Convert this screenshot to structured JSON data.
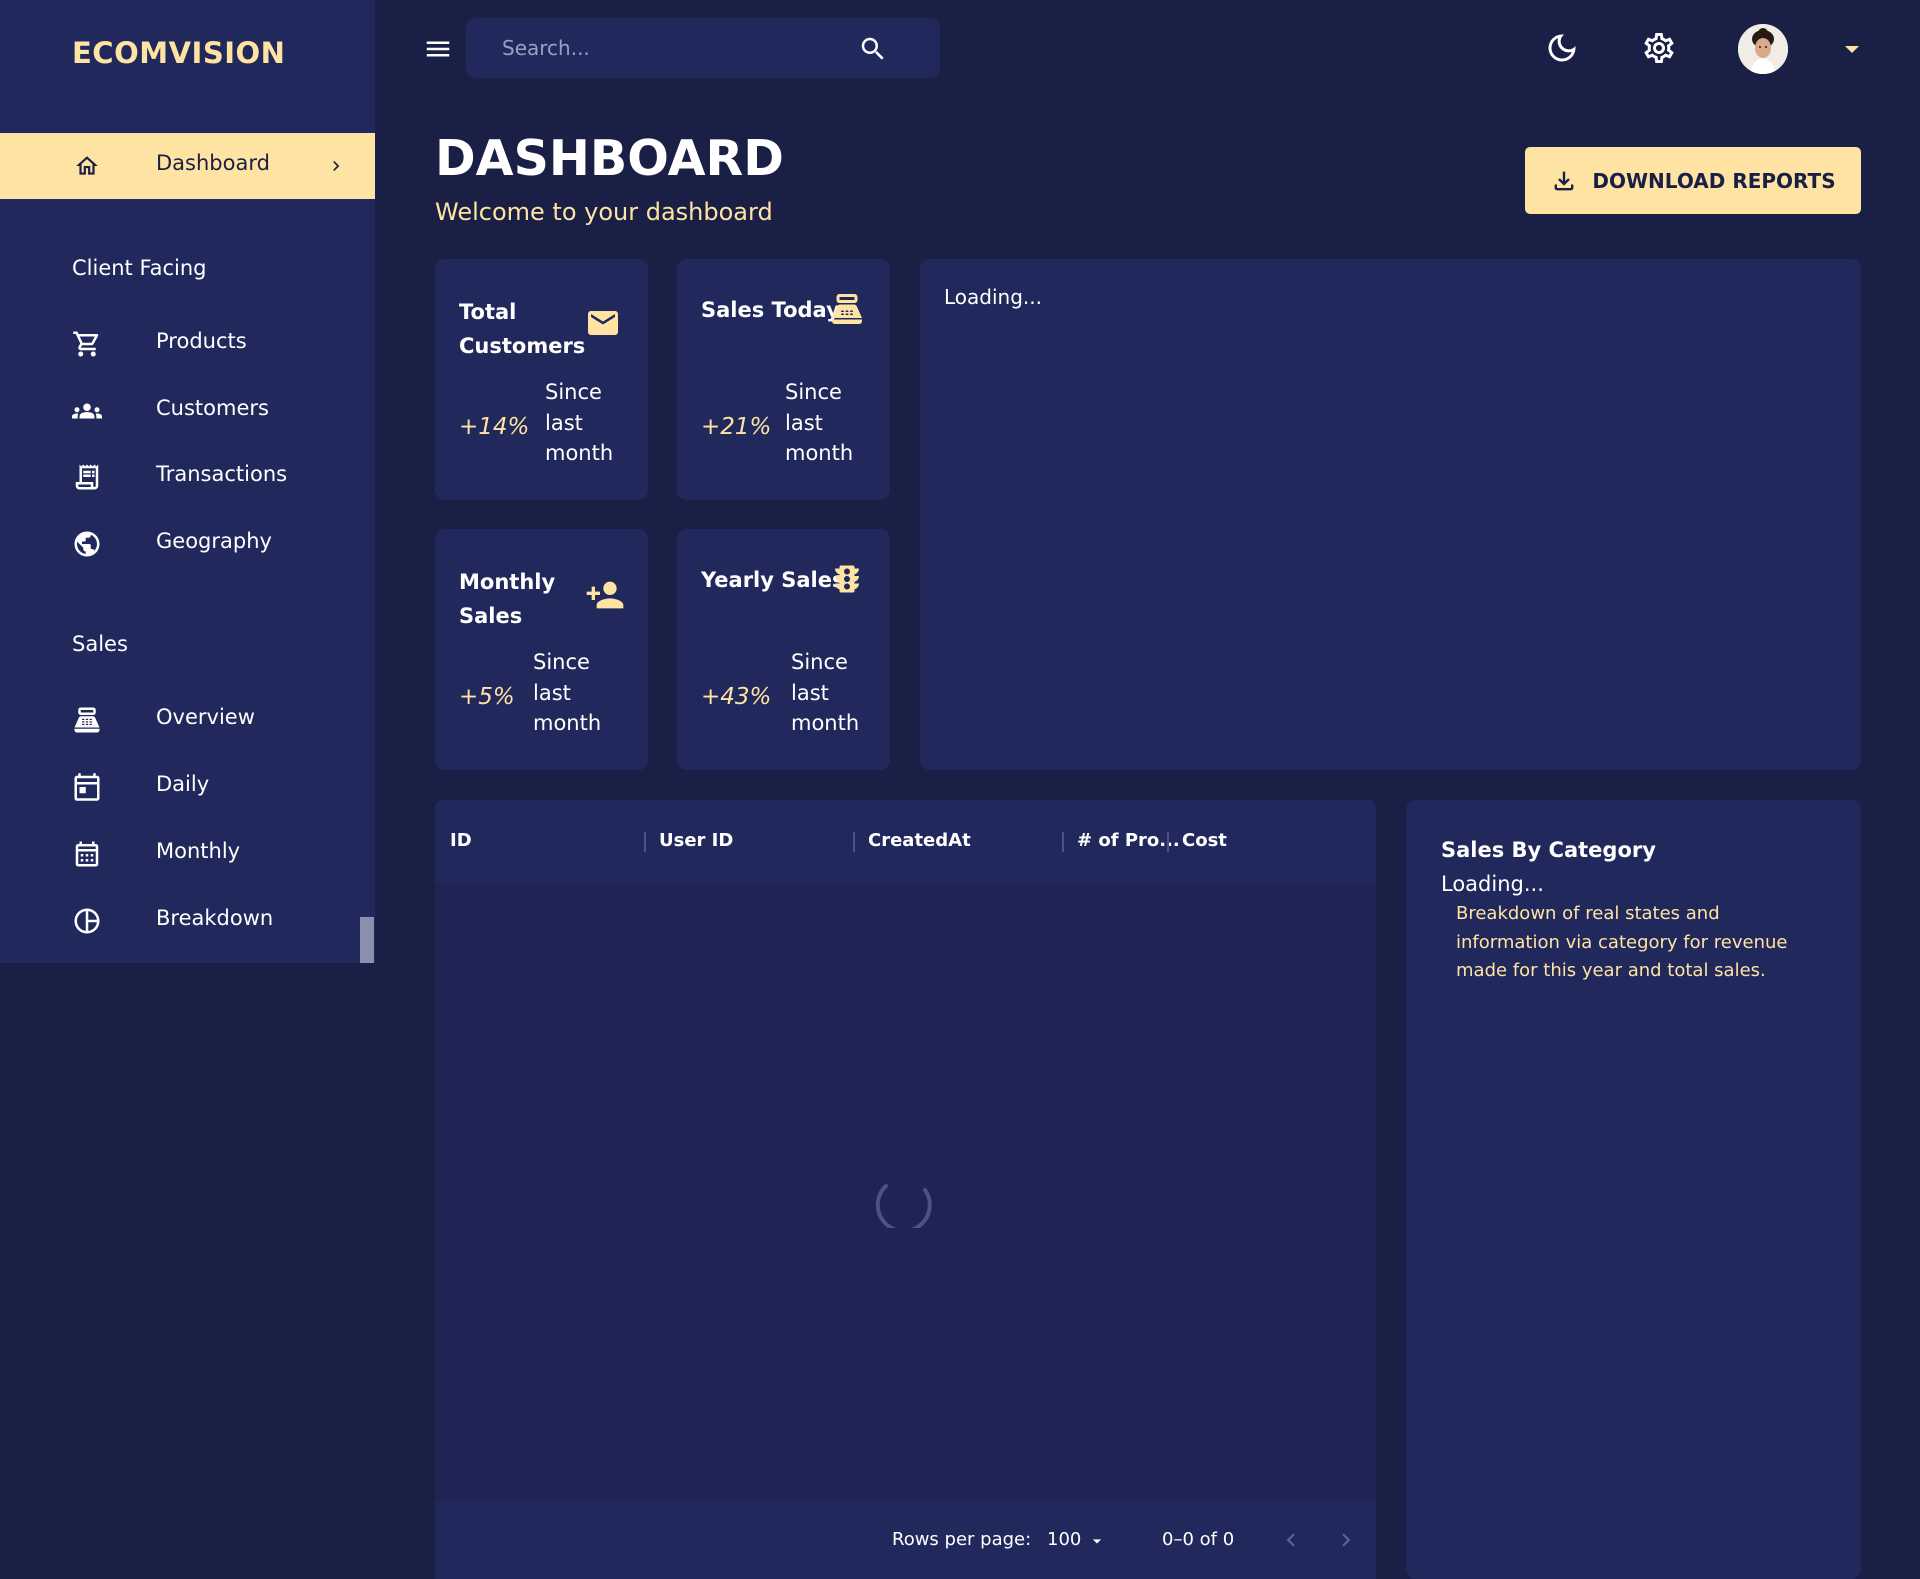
{
  "sidebar": {
    "brand": "ECOMVISION",
    "active_item": {
      "label": "Dashboard",
      "icon": "home-icon"
    },
    "sections": [
      {
        "title": "Client Facing",
        "items": [
          {
            "label": "Products",
            "icon": "shopping-cart-icon"
          },
          {
            "label": "Customers",
            "icon": "groups-icon"
          },
          {
            "label": "Transactions",
            "icon": "receipt-icon"
          },
          {
            "label": "Geography",
            "icon": "globe-icon"
          }
        ]
      },
      {
        "title": "Sales",
        "items": [
          {
            "label": "Overview",
            "icon": "point-of-sale-icon"
          },
          {
            "label": "Daily",
            "icon": "calendar-today-icon"
          },
          {
            "label": "Monthly",
            "icon": "calendar-month-icon"
          },
          {
            "label": "Breakdown",
            "icon": "pie-chart-icon"
          }
        ]
      }
    ]
  },
  "topbar": {
    "search_placeholder": "Search...",
    "icons": [
      "menu-icon",
      "search-icon",
      "dark-mode-icon",
      "settings-icon",
      "avatar",
      "arrow-drop-down-icon"
    ]
  },
  "header": {
    "title": "DASHBOARD",
    "subtitle": "Welcome to your dashboard",
    "download_label": "DOWNLOAD REPORTS"
  },
  "stats": [
    {
      "title_line1": "Total",
      "title_line2": "Customers",
      "increase": "+14%",
      "desc1": "Since",
      "desc2": "last",
      "desc3": "month",
      "icon": "email-icon"
    },
    {
      "title_line1": "Sales Today",
      "title_line2": "",
      "increase": "+21%",
      "desc1": "Since",
      "desc2": "last",
      "desc3": "month",
      "icon": "point-of-sale-icon"
    },
    {
      "title_line1": "Monthly",
      "title_line2": "Sales",
      "increase": "+5%",
      "desc1": "Since",
      "desc2": "last",
      "desc3": "month",
      "icon": "person-add-icon"
    },
    {
      "title_line1": "Yearly Sales",
      "title_line2": "",
      "increase": "+43%",
      "desc1": "Since",
      "desc2": "last",
      "desc3": "month",
      "icon": "traffic-icon"
    }
  ],
  "overview_chart": {
    "loading": "Loading..."
  },
  "transactions_table": {
    "columns": [
      "ID",
      "User ID",
      "CreatedAt",
      "# of Pro...",
      "Cost"
    ],
    "rows_per_page_label": "Rows per page:",
    "rows_per_page_value": "100",
    "range_label": "0–0 of 0"
  },
  "category_panel": {
    "title": "Sales By Category",
    "loading": "Loading...",
    "description": "Breakdown of real states and information via category for revenue made for this year and total sales."
  },
  "colors": {
    "background": "#191f45",
    "panel": "#21295c",
    "accent": "#ffe3a3"
  }
}
